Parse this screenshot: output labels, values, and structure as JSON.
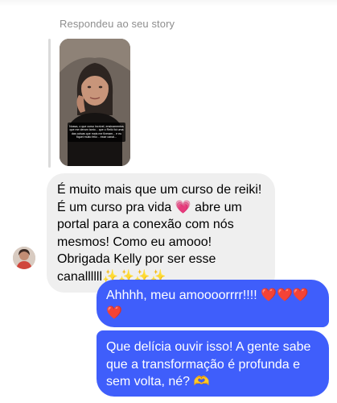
{
  "story_reply": {
    "label": "Respondeu ao seu story",
    "caption": "Nossa, o que curso incrível, ensinamentos que me deram tanto... que o Reiki foi uma das coisas que mais me fizeram... e eu fiquei muito feliz... esse canal..."
  },
  "incoming": {
    "text": "É muito mais que um curso de reiki! É um curso pra vida 💗 abre um portal para a conexão com nós mesmos! Como eu amooo! Obrigada Kelly por ser esse canallllll✨✨✨✨",
    "avatar_icon": "user-avatar"
  },
  "outgoing": [
    {
      "text": "Ahhhh, meu amoooorrrr!!!! ❤️❤️❤️❤️"
    },
    {
      "text": "Que delícia ouvir isso! A gente sabe que a transformação é profunda e sem volta, né? 🫶"
    }
  ],
  "colors": {
    "incoming_bubble": "#efefef",
    "outgoing_bubble": "#3f5efb",
    "meta_text": "#8e8e8e"
  }
}
